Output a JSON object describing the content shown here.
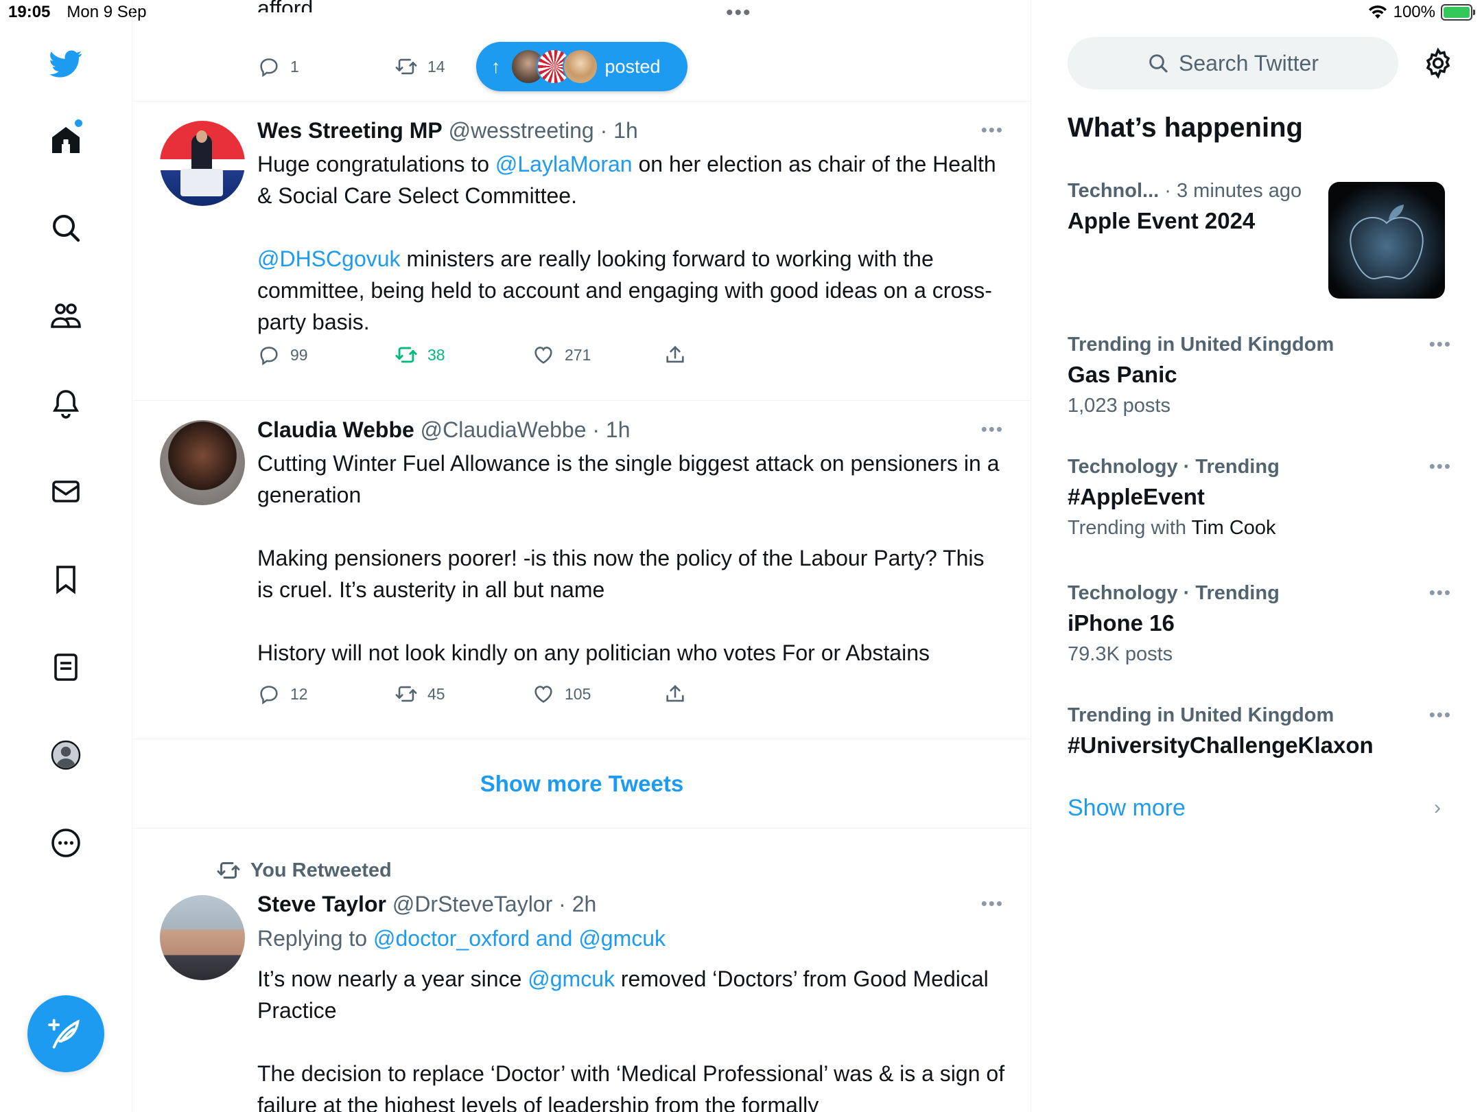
{
  "status_bar": {
    "time": "19:05",
    "date": "Mon 9 Sep",
    "battery": "100%",
    "top_dots": "•••"
  },
  "sidebar": {
    "items": [
      {
        "icon": "twitter-logo-icon"
      },
      {
        "icon": "home-icon",
        "label": "Home"
      },
      {
        "icon": "search-icon",
        "label": "Explore"
      },
      {
        "icon": "communities-icon",
        "label": "Communities"
      },
      {
        "icon": "bell-icon",
        "label": "Notifications"
      },
      {
        "icon": "mail-icon",
        "label": "Messages"
      },
      {
        "icon": "bookmark-icon",
        "label": "Bookmarks"
      },
      {
        "icon": "lists-icon",
        "label": "Lists"
      },
      {
        "icon": "profile-icon",
        "label": "Profile"
      },
      {
        "icon": "more-circle-icon",
        "label": "More"
      }
    ],
    "compose_icon": "compose-feather-icon",
    "accent": "#1d9bf0"
  },
  "new_posts_pill": {
    "label": "posted",
    "arrow": "↑"
  },
  "top_tweet": {
    "partial_text": "afford.",
    "replies": "1",
    "retweets": "14"
  },
  "tweets": [
    {
      "name": "Wes Streeting MP",
      "handle": "@wesstreeting",
      "time": "· 1h",
      "text_parts": {
        "p1a": "Huge congratulations to ",
        "p1_link": "@LaylaMoran",
        "p1b": " on her election as chair of the Health & Social Care Select Committee.",
        "p2_link": "@DHSCgovuk",
        "p2b": " ministers are really looking forward to working with the committee, being held to account and engaging with good ideas on a cross-party basis."
      },
      "replies": "99",
      "retweets": "38",
      "likes": "271"
    },
    {
      "name": "Claudia Webbe",
      "handle": "@ClaudiaWebbe",
      "time": "· 1h",
      "text_parts": {
        "p1": "Cutting Winter Fuel Allowance is the single biggest attack on pensioners in a generation",
        "p2": "Making pensioners poorer! -is this now the policy of the Labour Party? This is cruel. It’s austerity in all but name",
        "p3": "History will not look kindly on any politician who votes For or Abstains"
      },
      "replies": "12",
      "retweets": "45",
      "likes": "105"
    },
    {
      "retweeted_label": "You Retweeted",
      "name": "Steve Taylor",
      "handle": "@DrSteveTaylor",
      "time": "· 2h",
      "replying_prefix": "Replying to ",
      "replying_to": "@doctor_oxford and @gmcuk",
      "text_parts": {
        "p1a": "It’s now nearly a year since ",
        "p1_link": "@gmcuk",
        "p1b": " removed ‘Doctors’ from Good Medical Practice",
        "p2": "The decision to replace ‘Doctor’ with ‘Medical Professional’ was & is a sign of failure at the highest levels of leadership from the formally"
      }
    }
  ],
  "show_more_tweets": "Show more Tweets",
  "right_panel": {
    "search_placeholder": "Search Twitter",
    "section_title": "What’s happening",
    "trends": [
      {
        "context": "Technol...",
        "context_time": "· 3 minutes ago",
        "title": "Apple Event 2024",
        "has_image": true
      },
      {
        "context": "Trending in United Kingdom",
        "title": "Gas Panic",
        "sub": "1,023 posts"
      },
      {
        "context": "Technology · Trending",
        "title": "#AppleEvent",
        "sub_prefix": "Trending with ",
        "sub_name": "Tim Cook"
      },
      {
        "context": "Technology · Trending",
        "title": "iPhone 16",
        "sub": "79.3K posts"
      },
      {
        "context": "Trending in United Kingdom",
        "title": "#UniversityChallengeKlaxon"
      }
    ],
    "show_more": "Show more"
  },
  "colors": {
    "accent": "#1d9bf0",
    "retweet_green": "#00ba7c",
    "secondary_text": "#536471"
  }
}
